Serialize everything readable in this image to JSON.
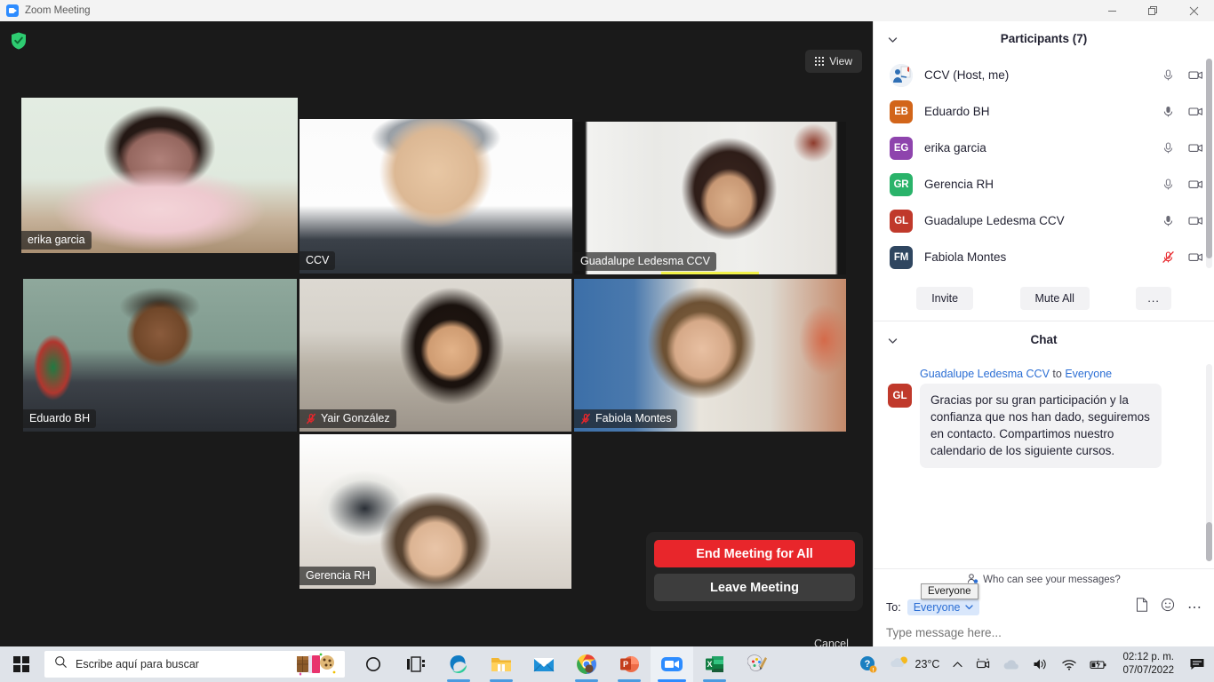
{
  "window": {
    "title": "Zoom Meeting",
    "app_icon": "zoom-camera-icon",
    "minimize": "—",
    "restore": "❐",
    "close": "✕"
  },
  "stage": {
    "encryption_icon": "green-shield-check-icon",
    "view_button": {
      "label": "View",
      "icon": "grid-icon"
    },
    "tiles": [
      {
        "name": "erika garcia",
        "active_speaker": true,
        "muted": false,
        "audio_bar": false
      },
      {
        "name": "CCV",
        "active_speaker": false,
        "muted": false,
        "audio_bar": false
      },
      {
        "name": "Guadalupe Ledesma CCV",
        "active_speaker": false,
        "muted": false,
        "audio_bar": true
      },
      {
        "name": "Eduardo BH",
        "active_speaker": false,
        "muted": false,
        "audio_bar": false
      },
      {
        "name": "Yair González",
        "active_speaker": false,
        "muted": true,
        "audio_bar": false
      },
      {
        "name": "Fabiola Montes",
        "active_speaker": false,
        "muted": true,
        "audio_bar": false
      },
      {
        "name": "Gerencia RH",
        "active_speaker": false,
        "muted": false,
        "audio_bar": false
      }
    ],
    "leave_dialog": {
      "end_for_all": "End Meeting for All",
      "leave": "Leave Meeting",
      "cancel": "Cancel",
      "end_color": "#e8262b"
    }
  },
  "participants_panel": {
    "title": "Participants (7)",
    "collapse_icon": "chevron-down-icon",
    "rows": [
      {
        "initials": "",
        "name": "CCV (Host, me)",
        "avatar_color": "#dfe6ef",
        "photo": true,
        "mic": "unmuted",
        "cam": "on"
      },
      {
        "initials": "EB",
        "name": "Eduardo BH",
        "avatar_color": "#d2651a",
        "photo": false,
        "mic": "unmuted-active",
        "cam": "on"
      },
      {
        "initials": "EG",
        "name": "erika garcia",
        "avatar_color": "#8e44ad",
        "photo": false,
        "mic": "unmuted",
        "cam": "on"
      },
      {
        "initials": "GR",
        "name": "Gerencia RH",
        "avatar_color": "#2ab36a",
        "photo": false,
        "mic": "unmuted",
        "cam": "on"
      },
      {
        "initials": "GL",
        "name": "Guadalupe Ledesma CCV",
        "avatar_color": "#c0392b",
        "photo": false,
        "mic": "unmuted-active",
        "cam": "on"
      },
      {
        "initials": "FM",
        "name": "Fabiola Montes",
        "avatar_color": "#2f4660",
        "photo": false,
        "mic": "muted",
        "cam": "on"
      }
    ],
    "actions": {
      "invite": "Invite",
      "mute_all": "Mute All",
      "more": "..."
    }
  },
  "chat_panel": {
    "title": "Chat",
    "collapse_icon": "chevron-down-icon",
    "message": {
      "sender": "Guadalupe Ledesma CCV",
      "to_word": " to ",
      "recipient": "Everyone",
      "avatar_initials": "GL",
      "avatar_color": "#c0392b",
      "body": "Gracias por su gran participación y la confianza que nos han dado, seguiremos en contacto. Compartimos nuestro calendario de los siguiente cursos."
    },
    "who_can_see": "Who can see your messages?",
    "who_can_see_icon": "person-add-icon",
    "to_label": "To:",
    "to_value": "Everyone",
    "to_chevron": "chevron-down-icon",
    "file_icon": "file-icon",
    "emoji_icon": "smiley-icon",
    "more_icon": "ellipsis-icon",
    "input_placeholder": "Type message here...",
    "tooltip": "Everyone"
  },
  "taskbar": {
    "start_icon": "windows-logo-icon",
    "search_placeholder": "Escribe aquí para buscar",
    "search_icon": "magnifier-icon",
    "search_art": "chocolate-cookie-icon",
    "apps": [
      {
        "name": "cortana-icon",
        "running": false,
        "active": false
      },
      {
        "name": "task-view-icon",
        "running": false,
        "active": false
      },
      {
        "name": "microsoft-edge-icon",
        "running": true,
        "active": false
      },
      {
        "name": "file-explorer-icon",
        "running": true,
        "active": false
      },
      {
        "name": "mail-icon",
        "running": false,
        "active": false
      },
      {
        "name": "google-chrome-icon",
        "running": true,
        "active": false
      },
      {
        "name": "powerpoint-icon",
        "running": true,
        "active": false
      },
      {
        "name": "zoom-icon",
        "running": true,
        "active": true
      },
      {
        "name": "excel-icon",
        "running": true,
        "active": false
      },
      {
        "name": "paint-icon",
        "running": false,
        "active": false
      }
    ],
    "tray": {
      "help_icon": "help-badge-icon",
      "weather_icon": "sun-cloud-icon",
      "temperature": "23°C",
      "overflow_icon": "chevron-up-icon",
      "camera_icon": "camera-privacy-icon",
      "onedrive_icon": "cloud-icon",
      "volume_icon": "speaker-icon",
      "wifi_icon": "wifi-icon",
      "battery_icon": "battery-icon",
      "time": "02:12 p. m.",
      "date": "07/07/2022",
      "action_center_icon": "notification-icon"
    }
  }
}
